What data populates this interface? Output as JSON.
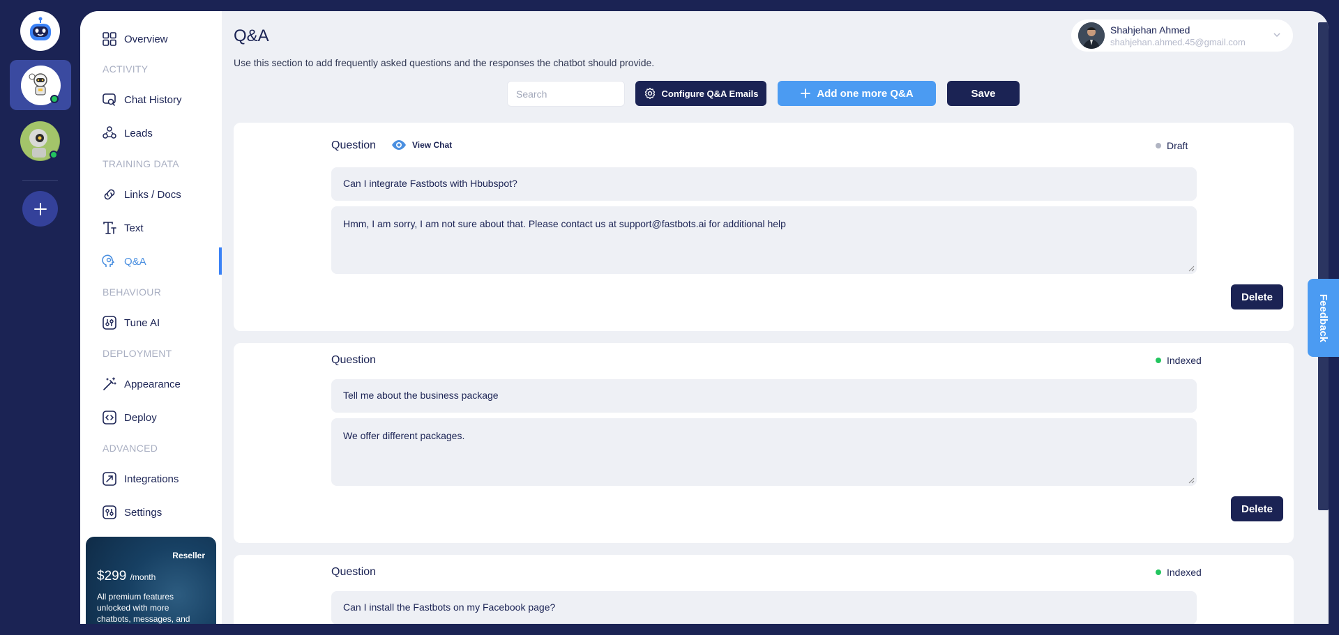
{
  "sidebar": {
    "overview": "Overview",
    "section_activity": "ACTIVITY",
    "chat_history": "Chat History",
    "leads": "Leads",
    "section_training": "TRAINING DATA",
    "links_docs": "Links / Docs",
    "text": "Text",
    "qa": "Q&A",
    "section_behaviour": "BEHAVIOUR",
    "tune_ai": "Tune AI",
    "section_deployment": "DEPLOYMENT",
    "appearance": "Appearance",
    "deploy": "Deploy",
    "section_advanced": "ADVANCED",
    "integrations": "Integrations",
    "settings": "Settings",
    "promo": {
      "tag": "Reseller",
      "price": "$299",
      "period": "/month",
      "description": "All premium features unlocked with more chatbots, messages, and"
    }
  },
  "header": {
    "title": "Q&A",
    "subtitle": "Use this section to add frequently asked questions and the responses the chatbot should provide.",
    "user_name": "Shahjehan Ahmed",
    "user_email": "shahjehan.ahmed.45@gmail.com"
  },
  "toolbar": {
    "search_placeholder": "Search",
    "configure_label": "Configure Q&A Emails",
    "add_label": "Add one more Q&A",
    "save_label": "Save"
  },
  "qa_items": [
    {
      "label": "Question",
      "view_chat": "View Chat",
      "status": "Draft",
      "status_color": "#b0b4c2",
      "question": "Can I integrate Fastbots with Hbubspot?",
      "answer": "Hmm, I am sorry, I am not sure about that. Please contact us at support@fastbots.ai for additional help",
      "delete_label": "Delete"
    },
    {
      "label": "Question",
      "status": "Indexed",
      "status_color": "#22c55e",
      "question": "Tell me about the business package",
      "answer": "We offer different packages.",
      "delete_label": "Delete"
    },
    {
      "label": "Question",
      "status": "Indexed",
      "status_color": "#22c55e",
      "question": "Can I install the Fastbots on my Facebook page?"
    }
  ],
  "feedback_label": "Feedback",
  "colors": {
    "navy": "#1b2354",
    "accent_blue": "#4b9bf2",
    "indexed_green": "#22c55e"
  }
}
